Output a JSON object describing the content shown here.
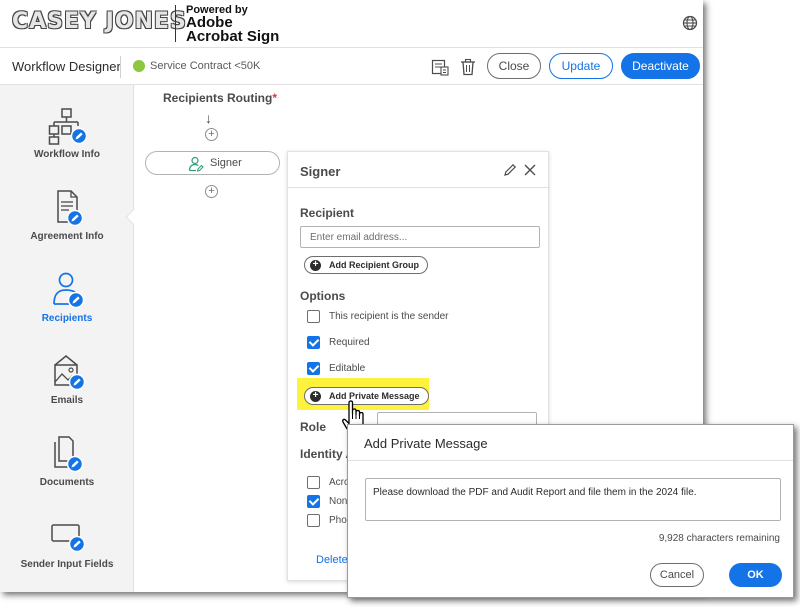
{
  "brand": {
    "logo_text": "CASEY JONES",
    "powered_by": "Powered by",
    "product_name": "Adobe Acrobat Sign"
  },
  "toolbar": {
    "title": "Workflow Designer",
    "workflow_name": "Service Contract <50K",
    "status_color": "#8dc63f",
    "close_label": "Close",
    "update_label": "Update",
    "deactivate_label": "Deactivate"
  },
  "sidebar": {
    "items": [
      {
        "label": "Workflow Info",
        "icon": "workflow-icon",
        "active": false
      },
      {
        "label": "Agreement Info",
        "icon": "agreement-icon",
        "active": false
      },
      {
        "label": "Recipients",
        "icon": "recipients-icon",
        "active": true
      },
      {
        "label": "Emails",
        "icon": "emails-icon",
        "active": false
      },
      {
        "label": "Documents",
        "icon": "documents-icon",
        "active": false
      },
      {
        "label": "Sender Input Fields",
        "icon": "sender-input-fields-icon",
        "active": false
      }
    ]
  },
  "routing": {
    "title": "Recipients Routing",
    "required_marker": "*",
    "node_label": "Signer"
  },
  "panel": {
    "title": "Signer",
    "recipient_label": "Recipient",
    "email_placeholder": "Enter email address...",
    "add_group_label": "Add Recipient Group",
    "options_label": "Options",
    "options": [
      {
        "label": "This recipient is the sender",
        "checked": false
      },
      {
        "label": "Required",
        "checked": true
      },
      {
        "label": "Editable",
        "checked": true
      }
    ],
    "add_private_message_label": "Add Private Message",
    "role_label": "Role",
    "identity_label": "Identity A",
    "identity_options": [
      {
        "label": "Acro",
        "checked": false
      },
      {
        "label": "None",
        "checked": true
      },
      {
        "label": "Phon",
        "checked": false
      }
    ],
    "delete_label": "Delete"
  },
  "modal": {
    "title": "Add Private Message",
    "message": "Please download the PDF and Audit Report and file them in the 2024 file.",
    "counter": "9,928 characters remaining",
    "cancel_label": "Cancel",
    "ok_label": "OK"
  },
  "colors": {
    "accent": "#1473e6",
    "highlight": "#fff23d",
    "required": "#d7373f"
  }
}
